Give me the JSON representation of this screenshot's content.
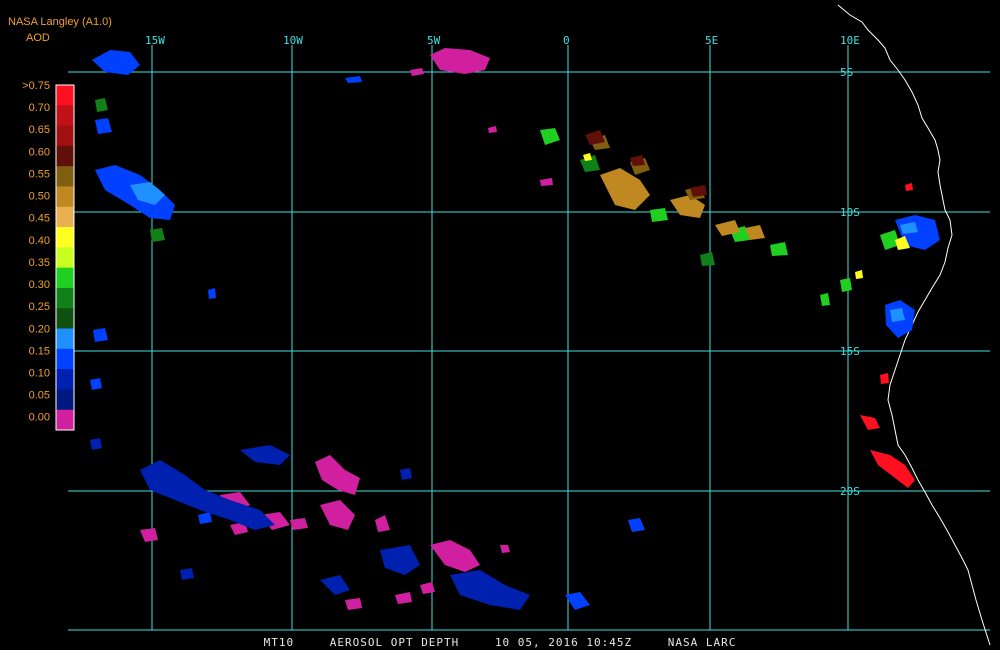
{
  "header": {
    "source": "NASA Langley (A1.0)",
    "product": "AOD"
  },
  "legend": {
    "labels": [
      ">0.75",
      "0.70",
      "0.65",
      "0.60",
      "0.55",
      "0.50",
      "0.45",
      "0.40",
      "0.35",
      "0.30",
      "0.25",
      "0.20",
      "0.15",
      "0.10",
      "0.05",
      "0.00"
    ],
    "colors": [
      "#ff1020",
      "#c01018",
      "#a01010",
      "#601008",
      "#806010",
      "#c08820",
      "#e8b050",
      "#ffff20",
      "#c8ff20",
      "#20d020",
      "#108018",
      "#105010",
      "#1e90ff",
      "#0040ff",
      "#0020b0",
      "#001880",
      "#d020a0"
    ]
  },
  "grid": {
    "lon_labels": [
      "15W",
      "10W",
      "5W",
      "0",
      "5E",
      "10E"
    ],
    "lat_labels": [
      "5S",
      "10S",
      "15S",
      "20S"
    ]
  },
  "footer": {
    "product": "MT10",
    "title": "AEROSOL OPT DEPTH",
    "datetime": "10 05, 2016 10:45Z",
    "agency": "NASA LARC"
  },
  "colors": {
    "grid": "#40e0e0",
    "coast": "#ffffff",
    "label": "#f0a030"
  }
}
